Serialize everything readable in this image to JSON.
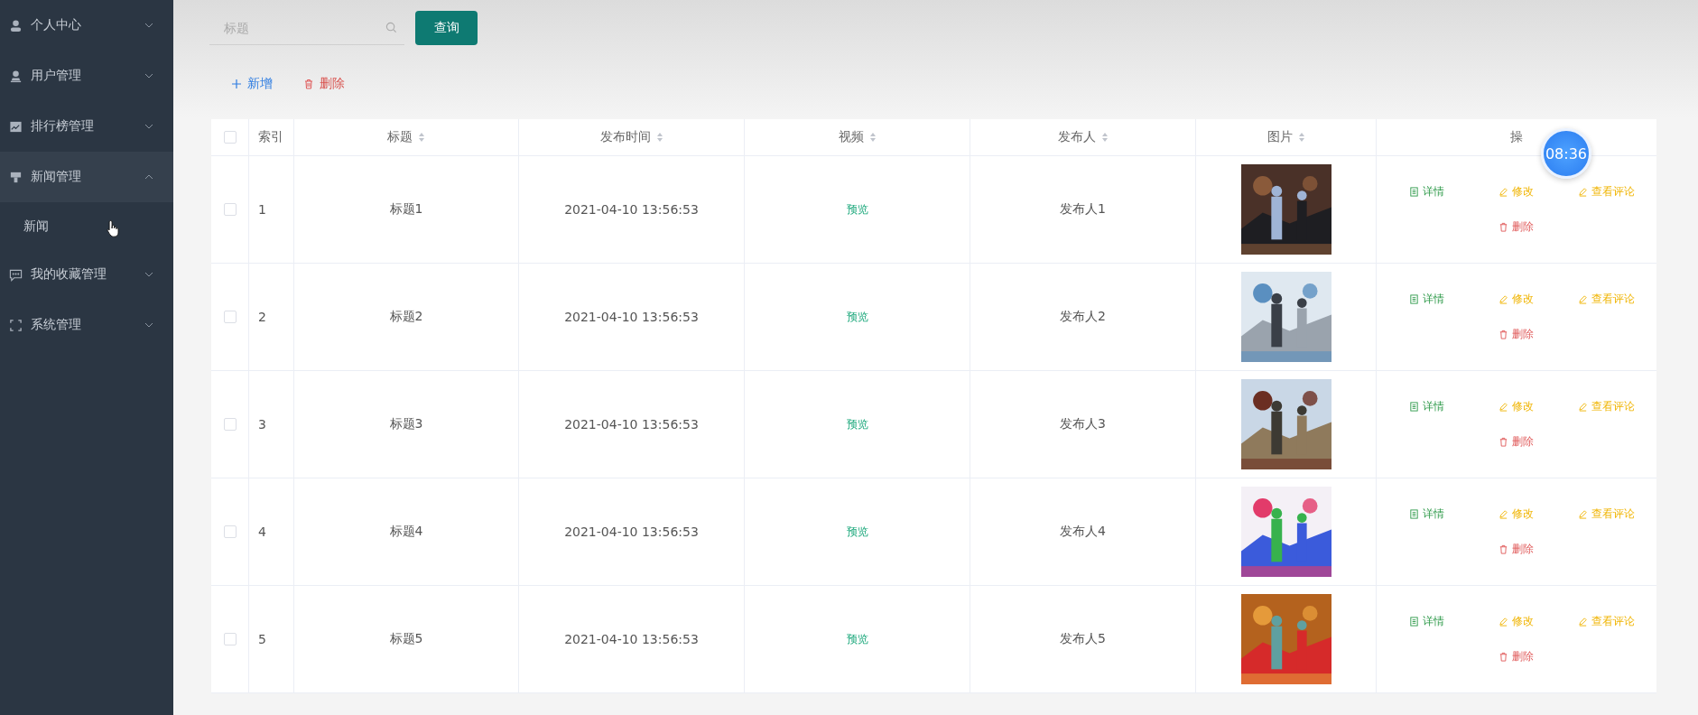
{
  "sidebar": {
    "items": [
      {
        "label": "个人中心",
        "expanded": false
      },
      {
        "label": "用户管理",
        "expanded": false
      },
      {
        "label": "排行榜管理",
        "expanded": false
      },
      {
        "label": "新闻管理",
        "expanded": true,
        "children": [
          {
            "label": "新闻"
          }
        ]
      },
      {
        "label": "我的收藏管理",
        "expanded": false
      },
      {
        "label": "系统管理",
        "expanded": false
      }
    ]
  },
  "search": {
    "placeholder": "标题",
    "button": "查询"
  },
  "toolbar": {
    "add": "新增",
    "delete": "删除"
  },
  "table": {
    "columns": [
      {
        "label": "索引",
        "sortable": false
      },
      {
        "label": "标题",
        "sortable": true
      },
      {
        "label": "发布时间",
        "sortable": true
      },
      {
        "label": "视频",
        "sortable": true
      },
      {
        "label": "发布人",
        "sortable": true
      },
      {
        "label": "图片",
        "sortable": true
      },
      {
        "label": "操",
        "sortable": false
      }
    ],
    "header_checked": false,
    "rows": [
      {
        "checked": false,
        "index": "1",
        "title": "标题1",
        "time": "2021-04-10 13:56:53",
        "video": "预览",
        "publisher": "发布人1",
        "picture": {
          "kind": "picture"
        },
        "actions": [
          "详情",
          "修改",
          "查看评论",
          "删除"
        ]
      },
      {
        "checked": false,
        "index": "2",
        "title": "标题2",
        "time": "2021-04-10 13:56:53",
        "video": "预览",
        "publisher": "发布人2",
        "picture": {
          "kind": "picture"
        },
        "actions": [
          "详情",
          "修改",
          "查看评论",
          "删除"
        ]
      },
      {
        "checked": false,
        "index": "3",
        "title": "标题3",
        "time": "2021-04-10 13:56:53",
        "video": "预览",
        "publisher": "发布人3",
        "picture": {
          "kind": "picture"
        },
        "actions": [
          "详情",
          "修改",
          "查看评论",
          "删除"
        ]
      },
      {
        "checked": false,
        "index": "4",
        "title": "标题4",
        "time": "2021-04-10 13:56:53",
        "video": "预览",
        "publisher": "发布人4",
        "picture": {
          "kind": "picture"
        },
        "actions": [
          "详情",
          "修改",
          "查看评论",
          "删除"
        ]
      },
      {
        "checked": false,
        "index": "5",
        "title": "标题5",
        "time": "2021-04-10 13:56:53",
        "video": "预览",
        "publisher": "发布人5",
        "picture": {
          "kind": "picture"
        },
        "actions": [
          "详情",
          "修改",
          "查看评论",
          "删除"
        ]
      }
    ]
  },
  "timer": "08:36"
}
